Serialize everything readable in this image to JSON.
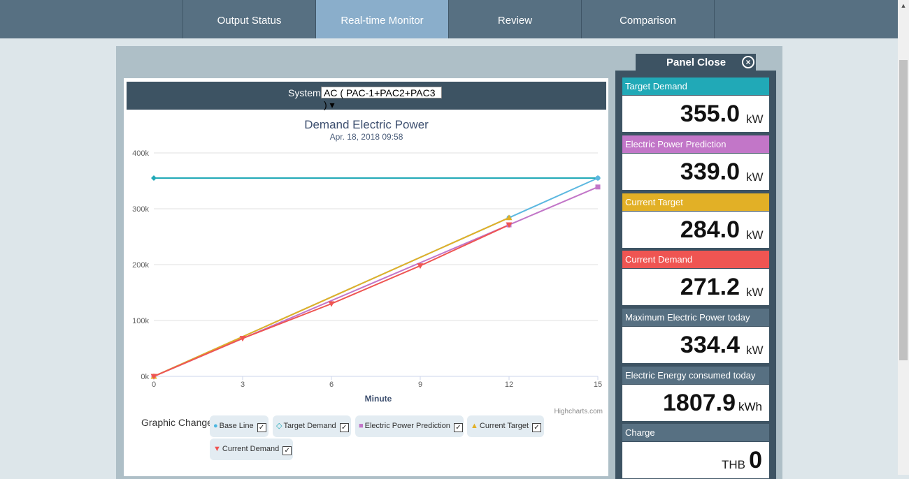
{
  "nav": {
    "tabs": [
      {
        "label": "Output Status"
      },
      {
        "label": "Real-time Monitor"
      },
      {
        "label": "Review"
      },
      {
        "label": "Comparison"
      }
    ]
  },
  "system": {
    "label": "System",
    "selected": "AC ( PAC-1+PAC2+PAC3 ) ▾"
  },
  "chart_data": {
    "type": "line",
    "title": "Demand Electric Power",
    "subtitle": "Apr. 18, 2018 09:58",
    "xlabel": "Minute",
    "ylabel": "",
    "credit": "Highcharts.com",
    "x": [
      0,
      3,
      6,
      9,
      12,
      15
    ],
    "xlim": [
      0,
      15
    ],
    "ylim": [
      0,
      400000
    ],
    "ytick_labels": [
      "0k",
      "100k",
      "200k",
      "300k",
      "400k"
    ],
    "xtick_labels": [
      "0",
      "3",
      "6",
      "9",
      "12",
      "15"
    ],
    "grid": true,
    "series": [
      {
        "key": "target",
        "color": "#21a9b7",
        "marker": "diamond",
        "x": [
          0,
          15
        ],
        "values": [
          355000,
          355000
        ]
      },
      {
        "key": "baseline",
        "color": "#5cb8e0",
        "marker": "circle",
        "x": [
          0,
          12,
          15
        ],
        "values": [
          0,
          284000,
          355000
        ]
      },
      {
        "key": "prediction",
        "color": "#c276c8",
        "marker": "square",
        "x": [
          0,
          12,
          15
        ],
        "values": [
          0,
          271200,
          339000
        ]
      },
      {
        "key": "current_target",
        "color": "#e2b026",
        "marker": "triangle",
        "x": [
          0,
          12
        ],
        "values": [
          0,
          284000
        ]
      },
      {
        "key": "current_demand",
        "color": "#ef5552",
        "marker": "triangle-down",
        "x": [
          0,
          3,
          6,
          9,
          12
        ],
        "values": [
          0,
          68000,
          130000,
          198000,
          271200
        ]
      }
    ]
  },
  "graphic_change": {
    "label": "Graphic Change",
    "chips": [
      {
        "label": "Base Line",
        "marker": "●",
        "color": "#4ab6e0",
        "check": "✓"
      },
      {
        "label": "Target Demand",
        "marker": "◇",
        "color": "#21a9b7",
        "check": "✓"
      },
      {
        "label": "Electric Power Prediction",
        "marker": "■",
        "color": "#c276c8",
        "check": "✓"
      },
      {
        "label": "Current Target",
        "marker": "▲",
        "color": "#e2b026",
        "check": "✓"
      },
      {
        "label": "Current Demand",
        "marker": "▼",
        "color": "#ef5552",
        "check": "✓"
      }
    ]
  },
  "panel": {
    "close_label": "Panel Close",
    "close_icon": "⊗",
    "cards": [
      {
        "title": "Target Demand",
        "value": "355.0",
        "unit": "kW",
        "color": "#21a9b7"
      },
      {
        "title": "Electric Power Prediction",
        "value": "339.0",
        "unit": "kW",
        "color": "#c276c8"
      },
      {
        "title": "Current Target",
        "value": "284.0",
        "unit": "kW",
        "color": "#e2b026"
      },
      {
        "title": "Current Demand",
        "value": "271.2",
        "unit": "kW",
        "color": "#ef5552"
      },
      {
        "title": "Maximum Electric Power today",
        "value": "334.4",
        "unit": "kW",
        "color": "#577082"
      },
      {
        "title": "Electric Energy consumed today",
        "value": "1807.9",
        "unit": "kWh",
        "color": "#577082"
      },
      {
        "title": "Charge",
        "value": "0",
        "unit": "THB",
        "color": "#577082"
      }
    ]
  },
  "scrollbar": {
    "up_arrow": "▲"
  }
}
